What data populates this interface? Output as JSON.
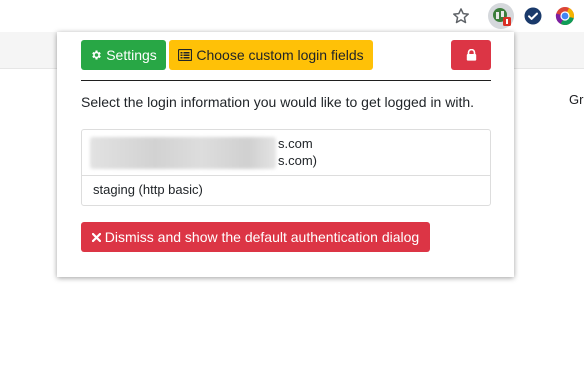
{
  "browser": {
    "background_page_text": "Gr",
    "toolbar_icons": [
      "star-icon",
      "login-extension-icon",
      "check-circle-icon",
      "chrome-logo-icon"
    ]
  },
  "popup": {
    "buttons": {
      "settings_label": "Settings",
      "choose_fields_label": "Choose custom login fields",
      "lock_icon": "lock-icon",
      "dismiss_label": "Dismiss and show the default authentication dialog"
    },
    "prompt": "Select the login information you would like to get logged in with.",
    "logins": [
      {
        "line1_suffix": "s.com",
        "line2_suffix": "s.com)",
        "redacted": true
      },
      {
        "label": "staging (http basic)"
      }
    ]
  },
  "colors": {
    "success": "#28a745",
    "warning": "#ffc107",
    "danger": "#dc3545"
  }
}
